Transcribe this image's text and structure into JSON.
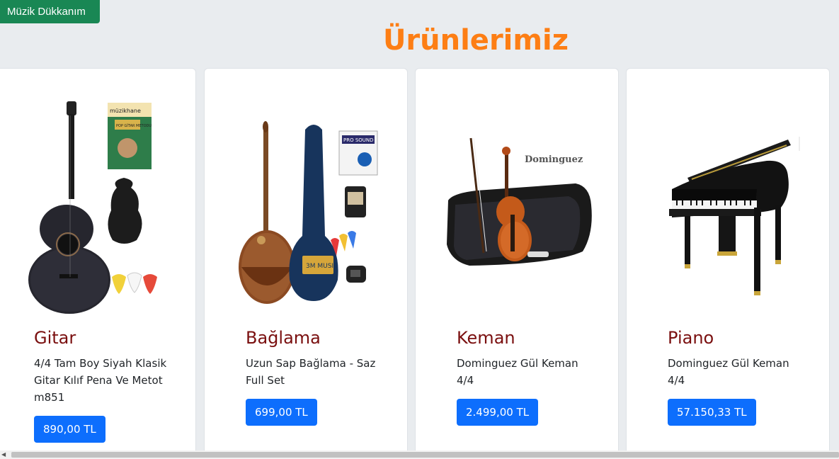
{
  "brand": {
    "label": "Müzik Dükkanım",
    "color": "#198754"
  },
  "page": {
    "title": "Ürünlerimiz",
    "title_color": "#fd7e14",
    "background": "#e9ecef"
  },
  "products": [
    {
      "name": "Gitar",
      "description": "4/4 Tam Boy Siyah Klasik Gitar Kılıf Pena Ve Metot m851",
      "price": "890,00 TL",
      "image_icon": "guitar-set-image"
    },
    {
      "name": "Bağlama",
      "description": "Uzun Sap Bağlama - Saz Full Set",
      "price": "699,00 TL",
      "image_icon": "baglama-set-image"
    },
    {
      "name": "Keman",
      "description": "Dominguez Gül Keman 4/4",
      "price": "2.499,00 TL",
      "image_icon": "violin-case-image"
    },
    {
      "name": "Piano",
      "description": "Dominguez Gül Keman 4/4",
      "price": "57.150,33 TL",
      "image_icon": "grand-piano-image"
    }
  ],
  "images": {
    "metot_book": "müzikhane",
    "metot_book_sub": "POP GİTAR METODU",
    "case_print": "3M MUSIC",
    "strings_pack": "PRO SOUND",
    "violin_brand": "Dominguez"
  },
  "price_button_color": "#0d6efd",
  "product_title_color": "#7a0f0f"
}
